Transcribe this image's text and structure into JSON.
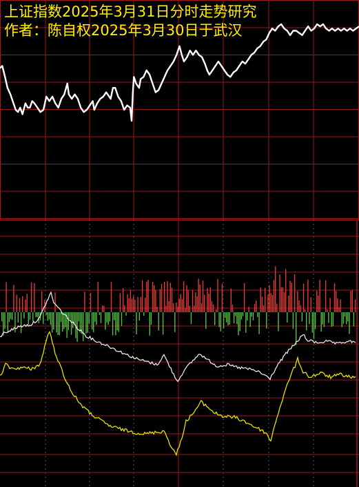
{
  "header": {
    "title": "上证指数2025年3月31日分时走势研究",
    "author_line": "作者：陈自权2025年3月30日于武汉"
  },
  "colors": {
    "background": "#000000",
    "grid": "#a01818",
    "grid_dotted": "#5a5a5a",
    "price_line": "#ffffff",
    "up_bar": "#e03a3a",
    "down_bar": "#55c040",
    "white_index": "#e8e8e8",
    "yellow_index": "#e8e000",
    "title": "#ffee00"
  },
  "chart_data": [
    {
      "type": "line",
      "name": "price",
      "points": [
        [
          0,
          0.69
        ],
        [
          1.5,
          0.7
        ],
        [
          3,
          0.66
        ],
        [
          5,
          0.6
        ],
        [
          7,
          0.57
        ],
        [
          9,
          0.53
        ],
        [
          10.5,
          0.5
        ],
        [
          12,
          0.49
        ],
        [
          13.5,
          0.51
        ],
        [
          15,
          0.48
        ],
        [
          17,
          0.53
        ],
        [
          18.5,
          0.51
        ],
        [
          20,
          0.51
        ],
        [
          21.5,
          0.54
        ],
        [
          23,
          0.53
        ],
        [
          25,
          0.51
        ],
        [
          27,
          0.49
        ],
        [
          29,
          0.5
        ],
        [
          31,
          0.56
        ],
        [
          33,
          0.54
        ],
        [
          35,
          0.56
        ],
        [
          37,
          0.53
        ],
        [
          39,
          0.51
        ],
        [
          41,
          0.55
        ],
        [
          43,
          0.57
        ],
        [
          45,
          0.62
        ],
        [
          46,
          0.57
        ],
        [
          48,
          0.55
        ],
        [
          50,
          0.57
        ],
        [
          52,
          0.55
        ],
        [
          54,
          0.51
        ],
        [
          56,
          0.49
        ],
        [
          58,
          0.5
        ],
        [
          60,
          0.52
        ],
        [
          62,
          0.54
        ],
        [
          63,
          0.5
        ],
        [
          65,
          0.53
        ],
        [
          67,
          0.55
        ],
        [
          69,
          0.56
        ],
        [
          71,
          0.58
        ],
        [
          73,
          0.56
        ],
        [
          74,
          0.55
        ],
        [
          75.5,
          0.6
        ],
        [
          77,
          0.6
        ],
        [
          79,
          0.56
        ],
        [
          81,
          0.54
        ],
        [
          83,
          0.5
        ],
        [
          85,
          0.52
        ],
        [
          87,
          0.51
        ],
        [
          88,
          0.45
        ],
        [
          88.8,
          0.58
        ],
        [
          89.5,
          0.65
        ],
        [
          91,
          0.62
        ],
        [
          93,
          0.6
        ],
        [
          94,
          0.64
        ],
        [
          96,
          0.65
        ],
        [
          98,
          0.68
        ],
        [
          100,
          0.66
        ],
        [
          102,
          0.62
        ],
        [
          104,
          0.58
        ],
        [
          106,
          0.59
        ],
        [
          108,
          0.62
        ],
        [
          110,
          0.65
        ],
        [
          112,
          0.68
        ],
        [
          114,
          0.7
        ],
        [
          116,
          0.72
        ],
        [
          118,
          0.75
        ],
        [
          120,
          0.79
        ],
        [
          121.5,
          0.75
        ],
        [
          123,
          0.72
        ],
        [
          125,
          0.74
        ],
        [
          127,
          0.77
        ],
        [
          129,
          0.75
        ],
        [
          131,
          0.77
        ],
        [
          133,
          0.75
        ],
        [
          135,
          0.74
        ],
        [
          137,
          0.71
        ],
        [
          138.5,
          0.68
        ],
        [
          140,
          0.66
        ],
        [
          142,
          0.68
        ],
        [
          144,
          0.7
        ],
        [
          146,
          0.72
        ],
        [
          148,
          0.7
        ],
        [
          150,
          0.68
        ],
        [
          152,
          0.66
        ],
        [
          154,
          0.65
        ],
        [
          156,
          0.67
        ],
        [
          158,
          0.68
        ],
        [
          160,
          0.7
        ],
        [
          162,
          0.72
        ],
        [
          164,
          0.71
        ],
        [
          166,
          0.73
        ],
        [
          168,
          0.75
        ],
        [
          170,
          0.76
        ],
        [
          172,
          0.78
        ],
        [
          174,
          0.79
        ],
        [
          176,
          0.81
        ],
        [
          178,
          0.82
        ],
        [
          180,
          0.85
        ],
        [
          182,
          0.87
        ],
        [
          184,
          0.86
        ],
        [
          186,
          0.88
        ],
        [
          188,
          0.89
        ],
        [
          190,
          0.87
        ],
        [
          192,
          0.86
        ],
        [
          194,
          0.84
        ],
        [
          196,
          0.86
        ],
        [
          198,
          0.86
        ],
        [
          200,
          0.85
        ],
        [
          202,
          0.84
        ],
        [
          204,
          0.86
        ],
        [
          206,
          0.88
        ],
        [
          208,
          0.86
        ],
        [
          210,
          0.87
        ],
        [
          212,
          0.89
        ],
        [
          214,
          0.88
        ],
        [
          216,
          0.89
        ],
        [
          218,
          0.87
        ],
        [
          220,
          0.86
        ],
        [
          222,
          0.87
        ],
        [
          224,
          0.86
        ],
        [
          226,
          0.87
        ],
        [
          228,
          0.86
        ],
        [
          230,
          0.87
        ],
        [
          232,
          0.86
        ],
        [
          234,
          0.87
        ],
        [
          236,
          0.86
        ],
        [
          238,
          0.87
        ],
        [
          240,
          0.88
        ]
      ]
    },
    {
      "type": "bar",
      "name": "volume_diff",
      "note_count": 120
    }
  ]
}
